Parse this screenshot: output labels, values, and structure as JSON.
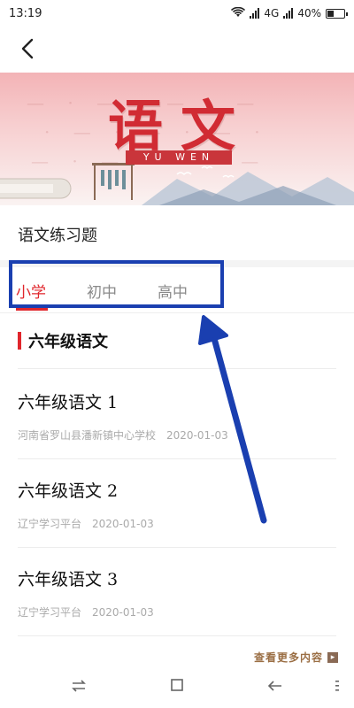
{
  "status_bar": {
    "time": "13:19",
    "network": "4G",
    "battery": "40%",
    "battery_level": 0.4,
    "icons": [
      "wifi-icon",
      "signal-icon",
      "battery-icon"
    ]
  },
  "nav": {
    "back_icon": "chevron-left-icon"
  },
  "banner": {
    "title": "语文",
    "subtitle": "YU WEN"
  },
  "page": {
    "section_title": "语文练习题"
  },
  "tabs": [
    {
      "label": "小学",
      "active": true
    },
    {
      "label": "初中",
      "active": false
    },
    {
      "label": "高中",
      "active": false
    }
  ],
  "list": {
    "heading": "六年级语文",
    "items": [
      {
        "title": "六年级语文 1",
        "source": "河南省罗山县潘新镇中心学校",
        "date": "2020-01-03"
      },
      {
        "title": "六年级语文 2",
        "source": "辽宁学习平台",
        "date": "2020-01-03"
      },
      {
        "title": "六年级语文 3",
        "source": "辽宁学习平台",
        "date": "2020-01-03"
      }
    ]
  },
  "more": {
    "label": "查看更多内容"
  },
  "bottom_nav": {
    "icons": [
      "recents-icon",
      "home-icon",
      "back-icon",
      "menu-icon"
    ]
  },
  "colors": {
    "accent": "#e0262c",
    "annotation": "#1a3fb0"
  }
}
